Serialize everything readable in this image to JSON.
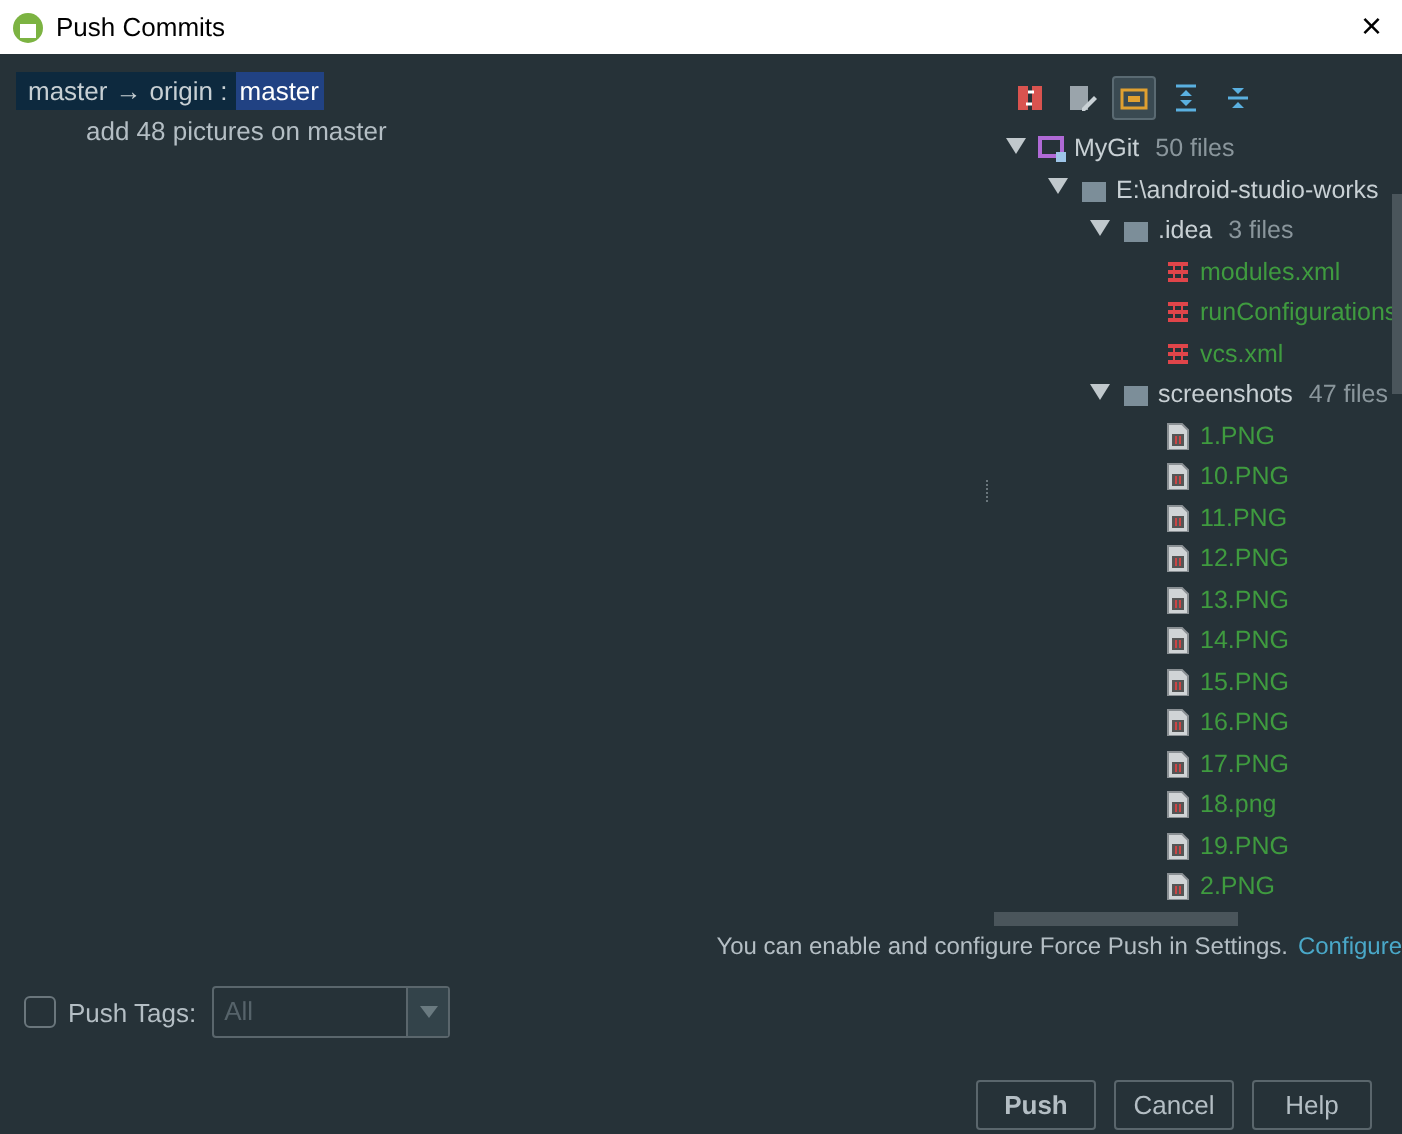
{
  "window": {
    "title": "Push Commits",
    "close": "×"
  },
  "push_spec": {
    "local": "master",
    "arrow": "→",
    "remote": "origin :",
    "target": "master"
  },
  "commits": [
    {
      "message": "add 48 pictures on master"
    }
  ],
  "toolbar": [
    {
      "kind": "diff",
      "selected": false
    },
    {
      "kind": "edit",
      "selected": false
    },
    {
      "kind": "group",
      "selected": true
    },
    {
      "kind": "expand",
      "selected": false
    },
    {
      "kind": "collapse",
      "selected": false
    }
  ],
  "tree": [
    {
      "kind": "module",
      "label": "MyGit",
      "count": "50 files",
      "expanded": true,
      "children": [
        {
          "kind": "folder",
          "label": "E:\\android-studio-works",
          "expanded": true,
          "children": [
            {
              "kind": "folder",
              "label": ".idea",
              "count": "3 files",
              "expanded": true,
              "children": [
                {
                  "kind": "xml",
                  "label": "modules.xml",
                  "color": "#3f9b3f"
                },
                {
                  "kind": "xml",
                  "label": "runConfigurations",
                  "color": "#3f9b3f"
                },
                {
                  "kind": "xml",
                  "label": "vcs.xml",
                  "color": "#3f9b3f"
                }
              ]
            },
            {
              "kind": "folder",
              "label": "screenshots",
              "count": "47 files",
              "expanded": true,
              "children": [
                {
                  "kind": "image",
                  "label": "1.PNG",
                  "color": "#3f9b3f"
                },
                {
                  "kind": "image",
                  "label": "10.PNG",
                  "color": "#3f9b3f"
                },
                {
                  "kind": "image",
                  "label": "11.PNG",
                  "color": "#3f9b3f"
                },
                {
                  "kind": "image",
                  "label": "12.PNG",
                  "color": "#3f9b3f"
                },
                {
                  "kind": "image",
                  "label": "13.PNG",
                  "color": "#3f9b3f"
                },
                {
                  "kind": "image",
                  "label": "14.PNG",
                  "color": "#3f9b3f"
                },
                {
                  "kind": "image",
                  "label": "15.PNG",
                  "color": "#3f9b3f"
                },
                {
                  "kind": "image",
                  "label": "16.PNG",
                  "color": "#3f9b3f"
                },
                {
                  "kind": "image",
                  "label": "17.PNG",
                  "color": "#3f9b3f"
                },
                {
                  "kind": "image",
                  "label": "18.png",
                  "color": "#3f9b3f"
                },
                {
                  "kind": "image",
                  "label": "19.PNG",
                  "color": "#3f9b3f"
                },
                {
                  "kind": "image",
                  "label": "2.PNG",
                  "color": "#3f9b3f"
                }
              ]
            }
          ]
        }
      ]
    }
  ],
  "force_push_hint": {
    "text": "You can enable and configure Force Push in Settings.",
    "link": "Configure"
  },
  "push_tags": {
    "label": "Push Tags:",
    "checked": false,
    "dropdown": {
      "value": "All",
      "disabled": true
    }
  },
  "buttons": [
    {
      "label": "Push",
      "default": true
    },
    {
      "label": "Cancel",
      "default": false
    },
    {
      "label": "Help",
      "default": false
    }
  ]
}
